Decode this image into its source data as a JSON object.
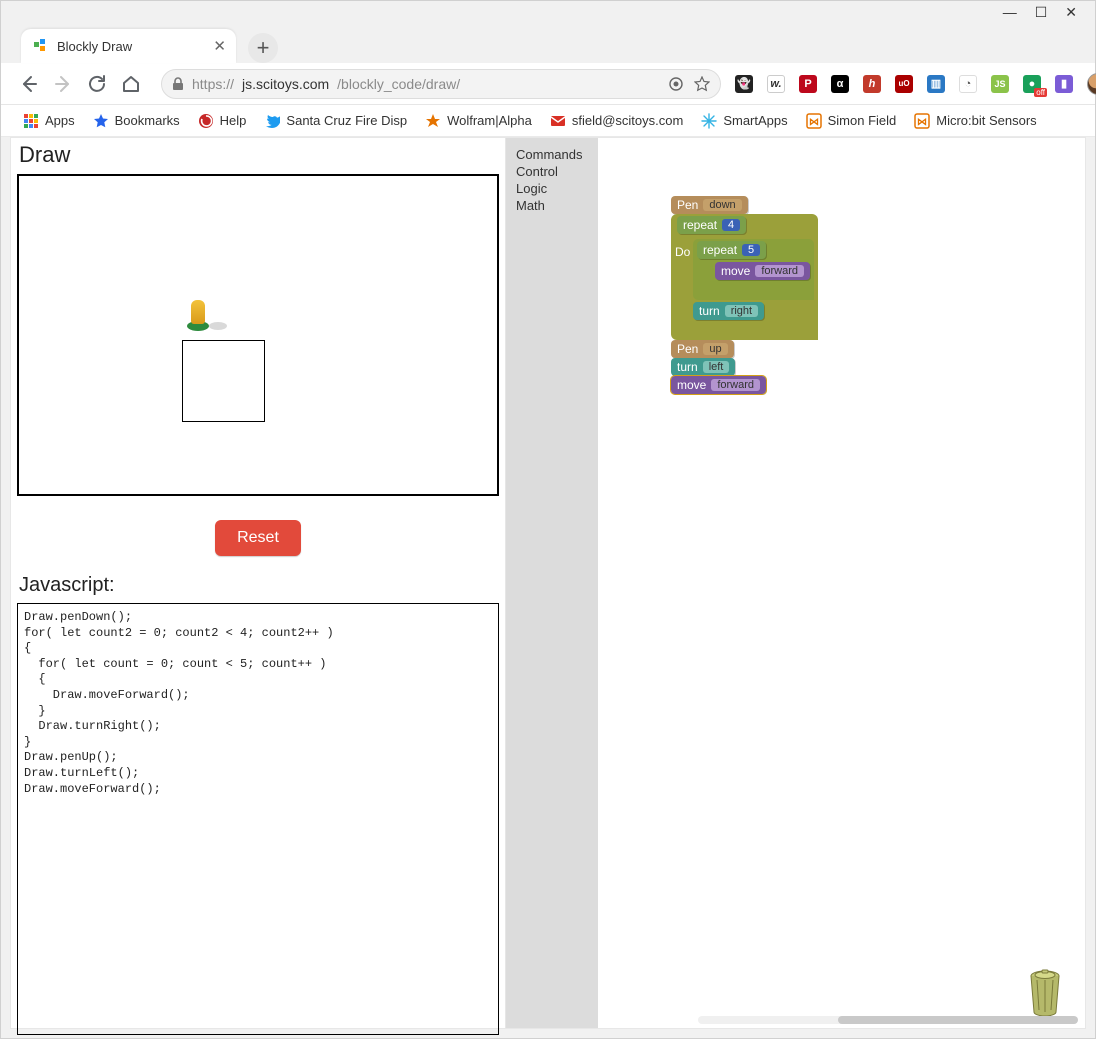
{
  "window": {
    "minimize": "—",
    "restore": "☐",
    "close": "✕"
  },
  "tab": {
    "title": "Blockly Draw",
    "close": "✕",
    "newtab": "+"
  },
  "addressbar": {
    "scheme": "https://",
    "host": "js.scitoys.com",
    "path": "/blockly_code/draw/"
  },
  "icons": {
    "back": "←",
    "forward": "→",
    "reload": "⟳",
    "home": "⌂",
    "lock": "🔒",
    "reader": "☰",
    "star": "☆",
    "kebab": "⋮"
  },
  "extensions": [
    {
      "name": "ghostery",
      "bg": "#222",
      "txt": "👻"
    },
    {
      "name": "w",
      "bg": "#fff",
      "txt": "w.",
      "fg": "#333"
    },
    {
      "name": "pinterest",
      "bg": "#bd081c",
      "txt": "P"
    },
    {
      "name": "alpha",
      "bg": "#000",
      "txt": "α"
    },
    {
      "name": "humble",
      "bg": "#c23a2b",
      "txt": "h"
    },
    {
      "name": "ublock",
      "bg": "#a00",
      "txt": "uO"
    },
    {
      "name": "weather",
      "bg": "#2a78c4",
      "txt": "▥"
    },
    {
      "name": "speed",
      "bg": "#fff",
      "txt": "◔",
      "fg": "#555"
    },
    {
      "name": "js",
      "bg": "#8bc34a",
      "txt": "JS"
    },
    {
      "name": "green",
      "bg": "#1aa05a",
      "txt": "●"
    },
    {
      "name": "off",
      "bg": "#e53935",
      "txt": "off"
    },
    {
      "name": "bar",
      "bg": "#7b5cd6",
      "txt": "▮"
    }
  ],
  "bookmarks": [
    {
      "name": "apps",
      "label": "Apps",
      "iconSvg": "grid",
      "color": ""
    },
    {
      "name": "bookmarks",
      "label": "Bookmarks",
      "iconSvg": "star",
      "color": "#2563eb"
    },
    {
      "name": "help",
      "label": "Help",
      "iconSvg": "swirl",
      "color": "#c62828"
    },
    {
      "name": "santa-cruz",
      "label": "Santa Cruz Fire Disp",
      "iconSvg": "bird",
      "color": "#1d9bf0"
    },
    {
      "name": "wolfram",
      "label": "Wolfram|Alpha",
      "iconSvg": "burst",
      "color": "#e57300"
    },
    {
      "name": "sfield",
      "label": "sfield@scitoys.com",
      "iconSvg": "mail",
      "color": "#d93025"
    },
    {
      "name": "smartapps",
      "label": "SmartApps",
      "iconSvg": "snow",
      "color": "#34b3e4"
    },
    {
      "name": "simon",
      "label": "Simon Field",
      "iconSvg": "brackets",
      "color": "#e57300"
    },
    {
      "name": "microbit",
      "label": "Micro:bit Sensors",
      "iconSvg": "brackets",
      "color": "#e57300"
    }
  ],
  "page": {
    "draw_heading": "Draw",
    "reset": "Reset",
    "js_heading": "Javascript:",
    "code": "Draw.penDown();\nfor( let count2 = 0; count2 < 4; count2++ )\n{\n  for( let count = 0; count < 5; count++ )\n  {\n    Draw.moveForward();\n  }\n  Draw.turnRight();\n}\nDraw.penUp();\nDraw.turnLeft();\nDraw.moveForward();",
    "toolbox": [
      "Commands",
      "Control",
      "Logic",
      "Math"
    ]
  },
  "blocks": {
    "pen": "Pen",
    "down": "down",
    "up": "up",
    "repeat": "repeat",
    "do": "Do",
    "turn": "turn",
    "right": "right",
    "left": "left",
    "move": "move",
    "forward": "forward",
    "r1": "4",
    "r2": "5"
  }
}
